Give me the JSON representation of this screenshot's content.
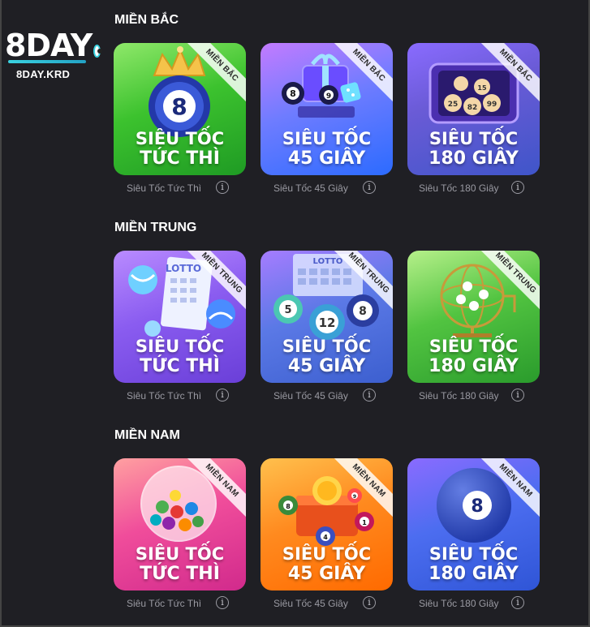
{
  "logo": {
    "main": "8DAY",
    "sub": "8DAY.KRD"
  },
  "sections": [
    {
      "title": "MIỀN BẮC",
      "cards": [
        {
          "ribbon": "MIỀN BẮC",
          "line1": "SIÊU TỐC",
          "line2": "TỨC THÌ",
          "caption": "Siêu Tốc Tức Thì"
        },
        {
          "ribbon": "MIỀN BẮC",
          "line1": "SIÊU TỐC",
          "line2": "45 GIÂY",
          "caption": "Siêu Tốc 45 Giây"
        },
        {
          "ribbon": "MIỀN BẮC",
          "line1": "SIÊU TỐC",
          "line2": "180 GIÂY",
          "caption": "Siêu Tốc 180 Giây"
        }
      ]
    },
    {
      "title": "MIỀN TRUNG",
      "cards": [
        {
          "ribbon": "MIỀN TRUNG",
          "line1": "SIÊU TỐC",
          "line2": "TỨC THÌ",
          "caption": "Siêu Tốc Tức Thì"
        },
        {
          "ribbon": "MIỀN TRUNG",
          "line1": "SIÊU TỐC",
          "line2": "45 GIÂY",
          "caption": "Siêu Tốc 45 Giây"
        },
        {
          "ribbon": "MIỀN TRUNG",
          "line1": "SIÊU TỐC",
          "line2": "180 GIÂY",
          "caption": "Siêu Tốc 180 Giây"
        }
      ]
    },
    {
      "title": "MIỀN NAM",
      "cards": [
        {
          "ribbon": "MIỀN NAM",
          "line1": "SIÊU TỐC",
          "line2": "TỨC THÌ",
          "caption": "Siêu Tốc Tức Thì"
        },
        {
          "ribbon": "MIỀN NAM",
          "line1": "SIÊU TỐC",
          "line2": "45 GIÂY",
          "caption": "Siêu Tốc 45 Giây"
        },
        {
          "ribbon": "MIỀN NAM",
          "line1": "SIÊU TỐC",
          "line2": "180 GIÂY",
          "caption": "Siêu Tốc 180 Giây"
        }
      ]
    }
  ],
  "art_labels": {
    "mb1": "8",
    "mb2_a": "8",
    "mb2_b": "9",
    "mb3_a": "25",
    "mb3_b": "82",
    "mb3_c": "99",
    "mb3_d": "15",
    "mt1_banner": "LOTTO",
    "mt2_banner": "LOTTO",
    "mt2_a": "5",
    "mt2_b": "12",
    "mt2_c": "8",
    "mn3": "8",
    "mn2_a": "8",
    "mn2_b": "4",
    "mn2_c": "1",
    "mn2_d": "9"
  },
  "info_icon_glyph": "i"
}
